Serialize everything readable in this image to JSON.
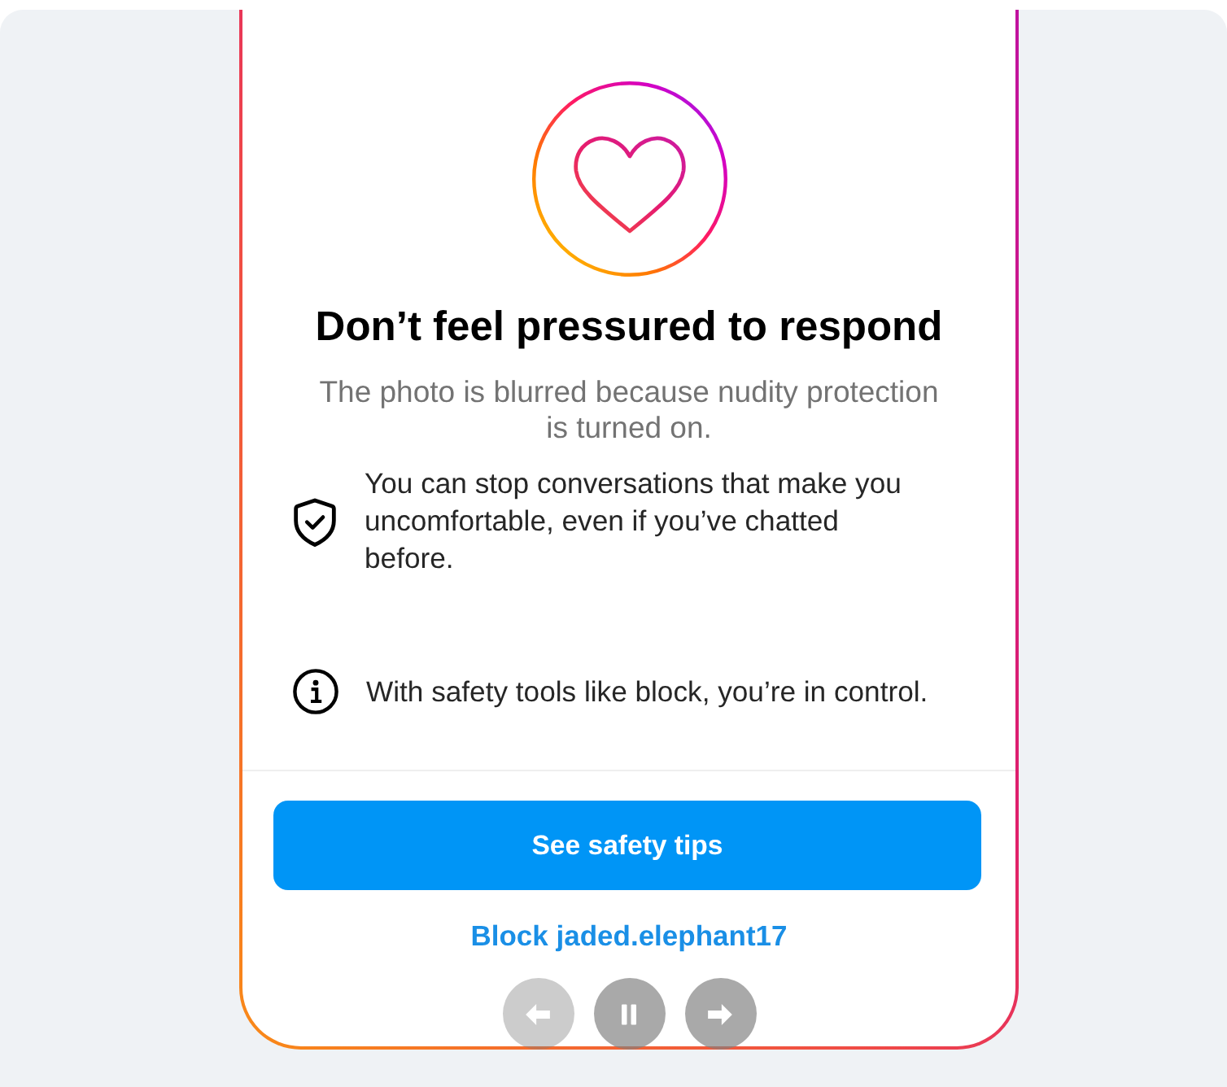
{
  "hero": {
    "title": "Don’t feel pressured to respond",
    "subtitle": "The photo is blurred because nudity protection is turned on."
  },
  "safety_points": [
    {
      "kind": "shield",
      "text": "You can stop conversations that make you uncomfortable, even if you’ve chatted before."
    },
    {
      "kind": "info",
      "text": "With safety tools like block, you’re in control."
    }
  ],
  "actions": {
    "primary_button": "See safety tips",
    "block_link": "Block jaded.elephant17"
  },
  "playback_controls": [
    {
      "kind": "previous",
      "disabled": true
    },
    {
      "kind": "pause",
      "disabled": false
    },
    {
      "kind": "next",
      "disabled": false
    }
  ]
}
